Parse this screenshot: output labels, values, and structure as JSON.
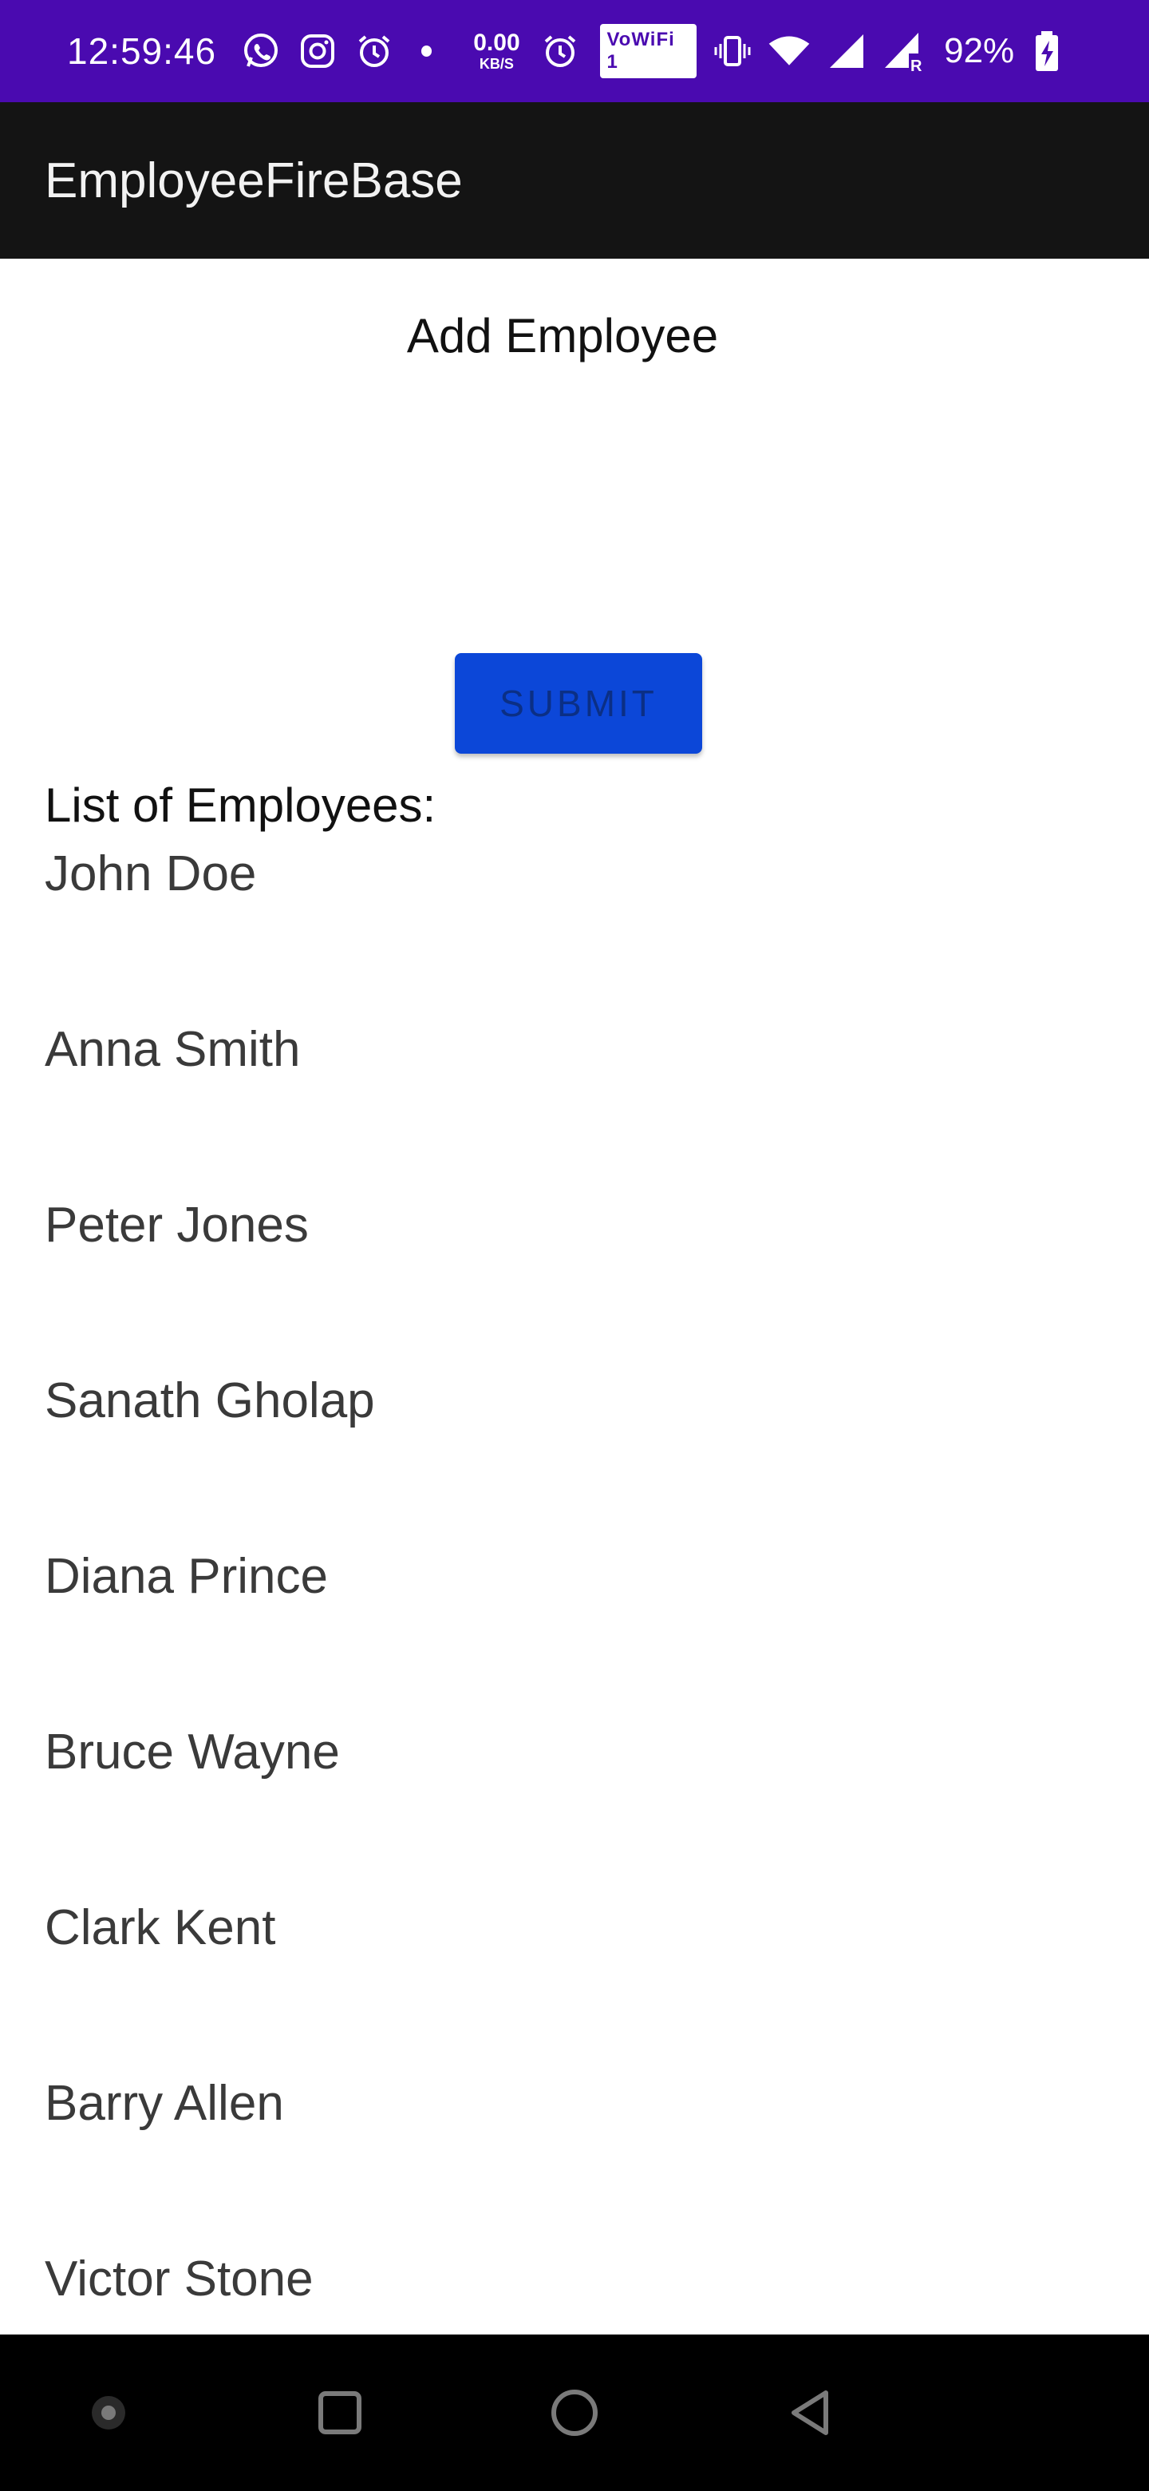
{
  "status_bar": {
    "time": "12:59:46",
    "net_speed_value": "0.00",
    "net_speed_unit": "KB/S",
    "vowifi_label": "VoWiFi 1",
    "battery_percent": "92%",
    "icons": [
      "whatsapp-icon",
      "instagram-icon",
      "alarm-icon",
      "notification-dot",
      "alarm-icon",
      "vibrate-icon",
      "wifi-icon",
      "signal-icon",
      "signal-roaming-icon",
      "battery-charging-icon"
    ]
  },
  "app_bar": {
    "title": "EmployeeFireBase"
  },
  "form": {
    "heading": "Add Employee",
    "submit_label": "SUBMIT"
  },
  "list": {
    "heading": "List of Employees:",
    "employees": [
      "John Doe",
      "Anna Smith",
      "Peter Jones",
      "Sanath Gholap",
      "Diana Prince",
      "Bruce Wayne",
      "Clark Kent",
      "Barry Allen",
      "Victor Stone"
    ]
  },
  "nav_bar": {
    "buttons": [
      "menu-dot-icon",
      "recents-square-icon",
      "home-circle-icon",
      "back-triangle-icon"
    ]
  },
  "colors": {
    "status_bar": "#4a0ab0",
    "app_bar": "#141414",
    "button": "#0c47d8",
    "nav_bar": "#000000"
  }
}
